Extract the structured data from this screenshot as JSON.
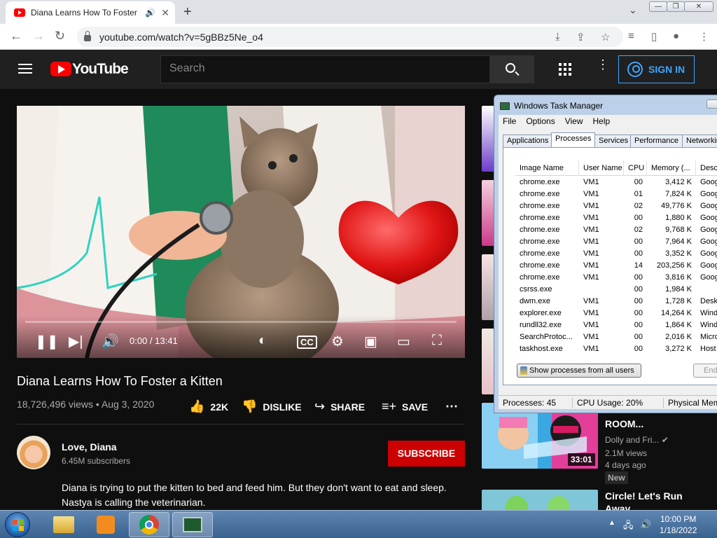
{
  "browser": {
    "tab_title": "Diana Learns How To Foster",
    "tab_audio": "🔊",
    "tab_close": "✕",
    "new_tab": "+",
    "tab_dropdown": "⌄",
    "url": "youtube.com/watch?v=5gBBz5Ne_o4",
    "window_buttons": [
      "—",
      "❐",
      "✕"
    ]
  },
  "youtube": {
    "logo_text": "YouTube",
    "search_placeholder": "Search",
    "signin_label": "SIGN IN"
  },
  "video": {
    "time": "0:00 / 13:41",
    "progress_fraction": 0.0
  },
  "watch": {
    "title": "Diana Learns How To Foster a Kitten",
    "meta": "18,726,496 views • Aug 3, 2020",
    "like_count": "22K",
    "dislike_label": "DISLIKE",
    "share_label": "SHARE",
    "save_label": "SAVE",
    "channel_name": "Love, Diana",
    "channel_subs": "6.45M subscribers",
    "subscribe_label": "SUBSCRIBE",
    "description": "Diana is trying to put the kitten to bed and feed him. But they don't want to eat and sleep. Nastya is calling the veterinarian."
  },
  "sidebar": {
    "featured": {
      "title": "ROOM...",
      "channel": "Dolly and Fri...",
      "views": "2.1M views",
      "age": "4 days ago",
      "badge": "New",
      "duration": "33:01"
    },
    "next_title": "Circle! Let's Run",
    "next_title_2": "Away"
  },
  "task_manager": {
    "title": "Windows Task Manager",
    "menu": [
      "File",
      "Options",
      "View",
      "Help"
    ],
    "tabs": [
      "Applications",
      "Processes",
      "Services",
      "Performance",
      "Networking"
    ],
    "active_tab": "Processes",
    "columns": [
      "Image Name",
      "User Name",
      "CPU",
      "Memory (...",
      "Desc"
    ],
    "rows": [
      [
        "chrome.exe",
        "VM1",
        "00",
        "3,412 K",
        "Goog"
      ],
      [
        "chrome.exe",
        "VM1",
        "01",
        "7,824 K",
        "Goog"
      ],
      [
        "chrome.exe",
        "VM1",
        "02",
        "49,776 K",
        "Goog"
      ],
      [
        "chrome.exe",
        "VM1",
        "00",
        "1,880 K",
        "Goog"
      ],
      [
        "chrome.exe",
        "VM1",
        "02",
        "9,768 K",
        "Goog"
      ],
      [
        "chrome.exe",
        "VM1",
        "00",
        "7,964 K",
        "Goog"
      ],
      [
        "chrome.exe",
        "VM1",
        "00",
        "3,352 K",
        "Goog"
      ],
      [
        "chrome.exe",
        "VM1",
        "14",
        "203,256 K",
        "Goog"
      ],
      [
        "chrome.exe",
        "VM1",
        "00",
        "3,816 K",
        "Goog"
      ],
      [
        "csrss.exe",
        "",
        "00",
        "1,984 K",
        ""
      ],
      [
        "dwm.exe",
        "VM1",
        "00",
        "1,728 K",
        "Desk"
      ],
      [
        "explorer.exe",
        "VM1",
        "00",
        "14,264 K",
        "Wind"
      ],
      [
        "rundll32.exe",
        "VM1",
        "00",
        "1,864 K",
        "Wind"
      ],
      [
        "SearchProtoc...",
        "VM1",
        "00",
        "2,016 K",
        "Micro"
      ],
      [
        "taskhost.exe",
        "VM1",
        "00",
        "3,272 K",
        "Host"
      ]
    ],
    "show_all_label": "Show processes from all users",
    "end_label": "End",
    "status": [
      "Processes: 45",
      "CPU Usage: 20%",
      "Physical Mem"
    ]
  },
  "taskbar": {
    "time": "10:00 PM",
    "date": "1/18/2022"
  }
}
